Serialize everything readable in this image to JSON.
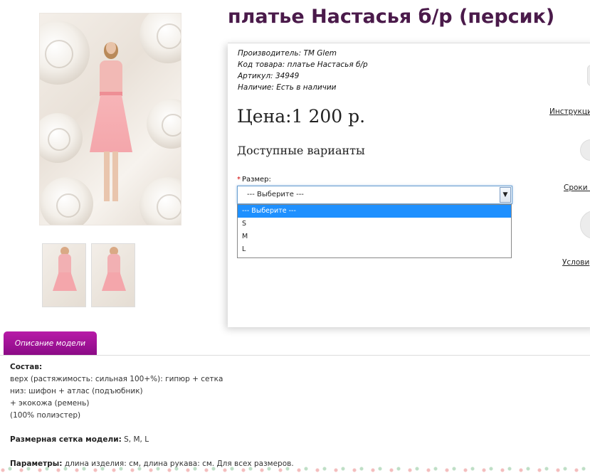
{
  "product": {
    "title": "платье Настасья б/р (персик)",
    "meta": {
      "manufacturer_label": "Производитель:",
      "manufacturer_value": "ТМ Glem",
      "code_label": "Код товара:",
      "code_value": "платье Настасья б/р",
      "sku_label": "Артикул:",
      "sku_value": "34949",
      "availability_label": "Наличие:",
      "availability_value": "Есть в наличии"
    },
    "price": "Цена:1 200 р.",
    "variants_heading": "Доступные варианты",
    "size": {
      "required_mark": "*",
      "label": "Размер:",
      "selected": "--- Выберите ---",
      "options": [
        "--- Выберите ---",
        "S",
        "M",
        "L"
      ]
    }
  },
  "side_links": {
    "instructions": "Инструкци",
    "terms": "Сроки д",
    "conditions": "Услови"
  },
  "tabs": {
    "description": "Описание модели"
  },
  "description": {
    "composition_heading": "Состав:",
    "line1": "верх (растяжимость: сильная 100+%): гипюр + сетка",
    "line2": "низ: шифон + атлас (подъюбник)",
    "line3": "+ экокожа (ремень)",
    "line4": "(100% полиэстер)",
    "size_grid_label": "Размерная сетка модели:",
    "size_grid_value": "S, M, L",
    "params_label": "Параметры:",
    "params_value": "длина изделия: см, длина рукава: см. Для всех размеров."
  },
  "colors": {
    "title": "#4a1a4a",
    "tab": "#9b1096",
    "selected_option": "#1e90ff",
    "required": "#d10000"
  }
}
